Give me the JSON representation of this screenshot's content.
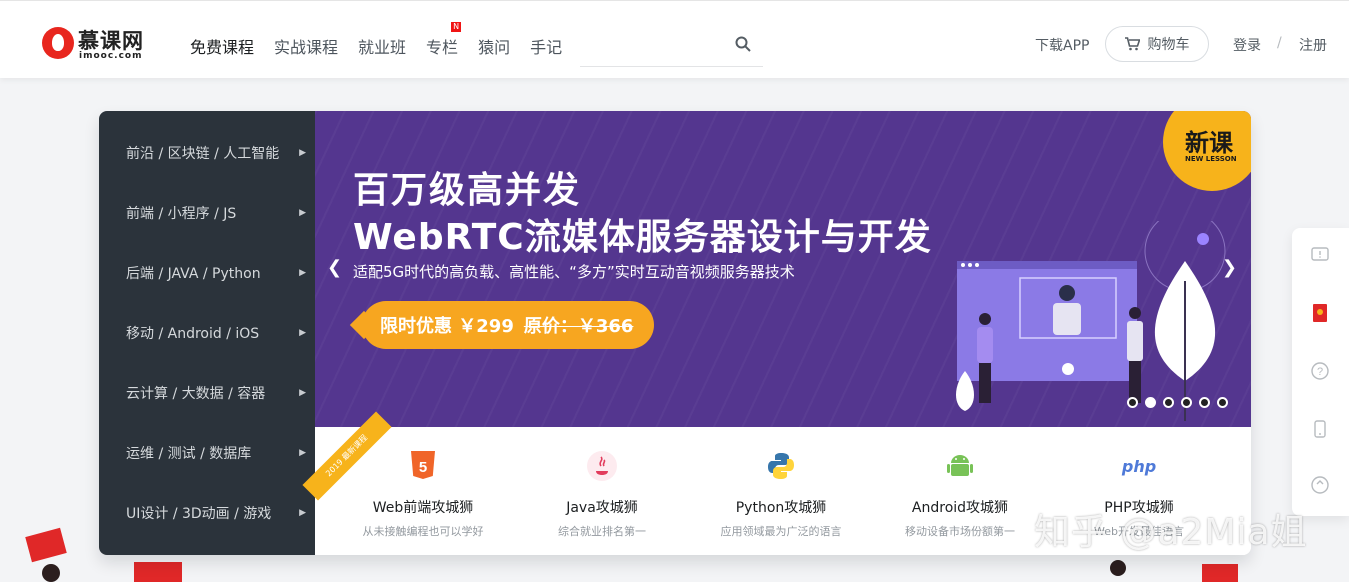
{
  "header": {
    "logo": {
      "cn": "慕课网",
      "en": "imooc.com"
    },
    "nav": [
      {
        "label": "免费课程",
        "active": true
      },
      {
        "label": "实战课程"
      },
      {
        "label": "就业班"
      },
      {
        "label": "专栏",
        "badge": "N"
      },
      {
        "label": "猿问"
      },
      {
        "label": "手记"
      }
    ],
    "search_placeholder": "",
    "app_link": "下载APP",
    "cart_label": "购物车",
    "login": "登录",
    "separator": "/",
    "register": "注册"
  },
  "categories": [
    "前沿 / 区块链 / 人工智能",
    "前端 / 小程序 / JS",
    "后端 / JAVA / Python",
    "移动 / Android / iOS",
    "云计算 / 大数据 / 容器",
    "运维 / 测试 / 数据库",
    "UI设计 / 3D动画 / 游戏"
  ],
  "banner": {
    "title_line1": "百万级高并发",
    "title_line2": "WebRTC流媒体服务器设计与开发",
    "subtitle": "适配5G时代的高负载、高性能、“多方”实时互动音视频服务器技术",
    "price_label": "限时优惠 ￥299",
    "price_original": "原价：￥366",
    "badge_cn": "新课",
    "badge_en": "NEW LESSON",
    "dots_total": 6,
    "dots_active_index": 1,
    "colors": {
      "background": "#54368f",
      "accent": "#f7a620"
    }
  },
  "courses": {
    "ribbon": "2019 最新课程",
    "items": [
      {
        "icon": "html5-icon",
        "name": "Web前端攻城狮",
        "desc": "从未接触编程也可以学好"
      },
      {
        "icon": "java-icon",
        "name": "Java攻城狮",
        "desc": "综合就业排名第一"
      },
      {
        "icon": "python-icon",
        "name": "Python攻城狮",
        "desc": "应用领域最为广泛的语言"
      },
      {
        "icon": "android-icon",
        "name": "Android攻城狮",
        "desc": "移动设备市场份额第一"
      },
      {
        "icon": "php-icon",
        "name": "PHP攻城狮",
        "desc": "Web开发最佳语言",
        "php_text": "php"
      }
    ]
  },
  "watermark": "知乎 @a2Mia姐"
}
